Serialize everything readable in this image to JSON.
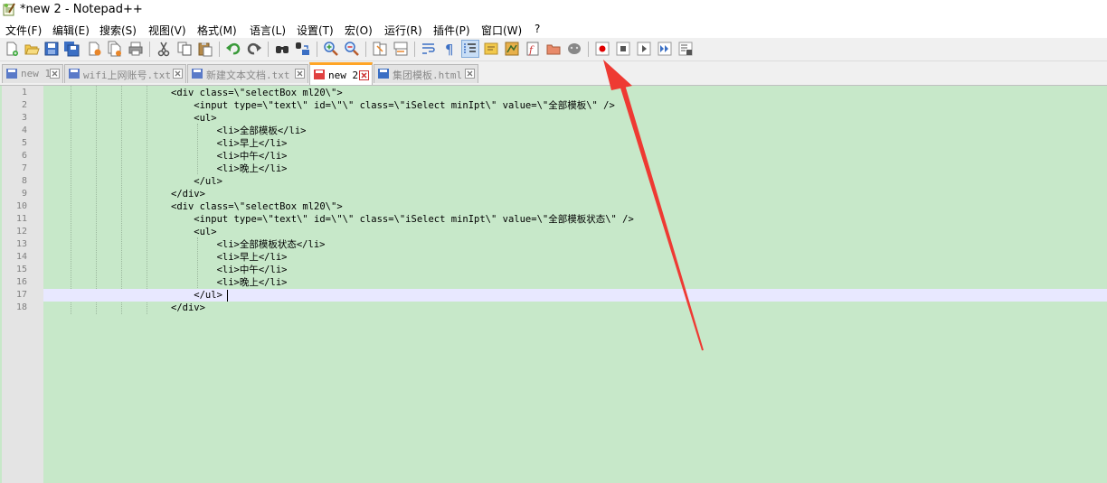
{
  "window": {
    "title": "*new 2 - Notepad++"
  },
  "menu": [
    "文件(F)",
    "编辑(E)",
    "搜索(S)",
    "视图(V)",
    "格式(M)",
    "语言(L)",
    "设置(T)",
    "宏(O)",
    "运行(R)",
    "插件(P)",
    "窗口(W)",
    "?"
  ],
  "toolbar": {
    "buttons": [
      "new-file",
      "open-file",
      "save",
      "save-all",
      "close",
      "close-all",
      "print",
      "cut",
      "copy",
      "paste",
      "undo",
      "redo",
      "find",
      "replace",
      "zoom-in",
      "zoom-out",
      "sync-vertical",
      "sync-horizontal",
      "word-wrap",
      "show-all-chars",
      "indent-guide",
      "user-defined-language",
      "document-map",
      "function-list",
      "folder-as-workspace",
      "monitoring",
      "start-recording",
      "stop-recording",
      "playback",
      "run-macro-multiple",
      "save-macro"
    ]
  },
  "tabs": [
    {
      "label": "new 1",
      "active": false,
      "modified": true
    },
    {
      "label": "wifi上网账号.txt",
      "active": false,
      "modified": true
    },
    {
      "label": "新建文本文档.txt",
      "active": false,
      "modified": true
    },
    {
      "label": "new 2",
      "active": true,
      "modified": true
    },
    {
      "label": "集团模板.html",
      "active": false,
      "modified": false
    }
  ],
  "editor": {
    "current_line": 17,
    "lines": [
      "<div class=\\\"selectBox ml20\\\">",
      "    <input type=\\\"text\\\" id=\\\"\\\" class=\\\"iSelect minIpt\\\" value=\\\"全部模板\\\" />",
      "    <ul>",
      "        <li>全部模板</li>",
      "        <li>早上</li>",
      "        <li>中午</li>",
      "        <li>晚上</li>",
      "    </ul>",
      "</div>",
      "<div class=\\\"selectBox ml20\\\">",
      "    <input type=\\\"text\\\" id=\\\"\\\" class=\\\"iSelect minIpt\\\" value=\\\"全部模板状态\\\" />",
      "    <ul>",
      "        <li>全部模板状态</li>",
      "        <li>早上</li>",
      "        <li>中午</li>",
      "        <li>晚上</li>",
      "    </ul>",
      "</div>"
    ],
    "line_numbers": [
      "1",
      "2",
      "3",
      "4",
      "5",
      "6",
      "7",
      "8",
      "9",
      "10",
      "11",
      "12",
      "13",
      "14",
      "15",
      "16",
      "17",
      "18"
    ]
  },
  "colors": {
    "editor_bg": "#c7e8c9",
    "current_line_bg": "#e8e8ff",
    "active_tab_accent": "#ffa526",
    "annotation_arrow": "#ee3a33",
    "record_dot": "#e00000"
  }
}
